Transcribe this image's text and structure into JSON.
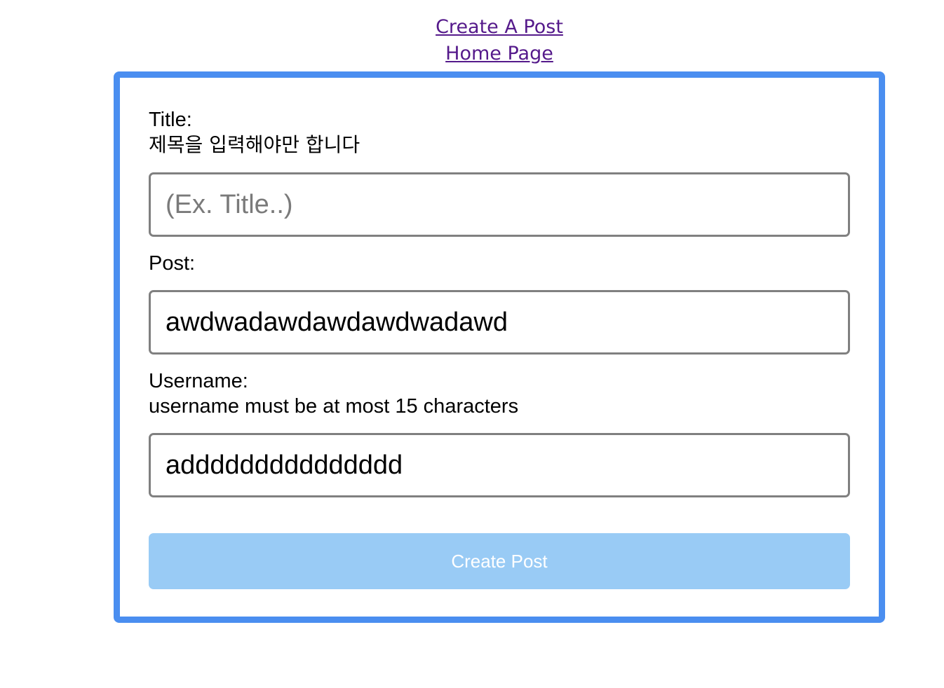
{
  "nav": {
    "create_post": "Create A Post",
    "home_page": "Home Page"
  },
  "form": {
    "title": {
      "label": "Title:",
      "error": "제목을 입력해야만 합니다",
      "value": "",
      "placeholder": "(Ex. Title..)"
    },
    "post": {
      "label": "Post:",
      "value": "awdwadawdawdawdwadawd"
    },
    "username": {
      "label": "Username:",
      "error": "username must be at most 15 characters",
      "value": "addddddddddddddd"
    },
    "submit_label": "Create Post"
  },
  "colors": {
    "card_border": "#4a8ef0",
    "link": "#551a8b",
    "button_bg": "#99cbf5",
    "input_border": "#808080"
  }
}
